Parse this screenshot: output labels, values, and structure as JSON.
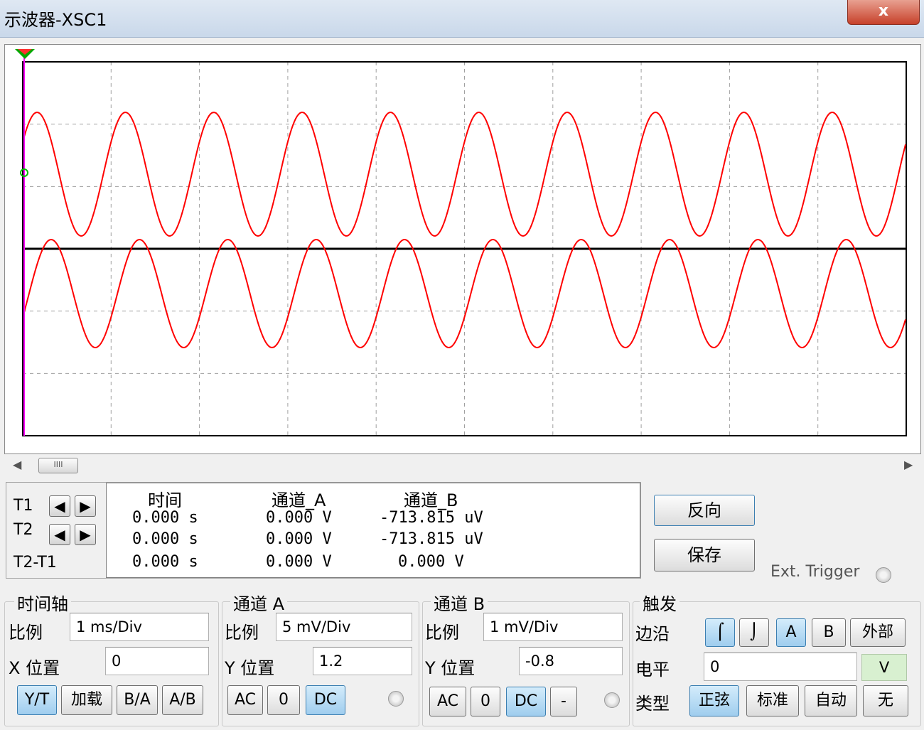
{
  "window": {
    "title": "示波器-XSC1",
    "close_label": "x"
  },
  "scroll": {
    "left": "◀",
    "right": "▶",
    "thumb": "IIII"
  },
  "cursors": {
    "t1_label": "T1",
    "t2_label": "T2",
    "diff_label": "T2-T1",
    "left_arrow": "◀",
    "right_arrow": "▶"
  },
  "readout": {
    "headers": [
      "时间",
      "通道_A",
      "通道_B"
    ],
    "rows": [
      [
        "0.000 s",
        "0.000 V",
        "-713.815 uV"
      ],
      [
        "0.000 s",
        "0.000 V",
        "-713.815 uV"
      ],
      [
        "0.000 s",
        "0.000 V",
        "0.000 V"
      ]
    ]
  },
  "actions": {
    "reverse": "反向",
    "save": "保存",
    "ext_trigger": "Ext. Trigger"
  },
  "timebase": {
    "title": "时间轴",
    "scale_label": "比例",
    "scale": "1 ms/Div",
    "xpos_label": "X 位置",
    "xpos": "0",
    "modes": [
      "Y/T",
      "加载",
      "B/A",
      "A/B"
    ],
    "active_mode": "Y/T"
  },
  "channel_a": {
    "title": "通道 A",
    "scale_label": "比例",
    "scale": "5 mV/Div",
    "ypos_label": "Y 位置",
    "ypos": "1.2",
    "coupling": [
      "AC",
      "0",
      "DC"
    ],
    "active": "DC"
  },
  "channel_b": {
    "title": "通道 B",
    "scale_label": "比例",
    "scale": "1 mV/Div",
    "ypos_label": "Y 位置",
    "ypos": "-0.8",
    "coupling": [
      "AC",
      "0",
      "DC",
      "-"
    ],
    "active": "DC"
  },
  "trigger": {
    "title": "触发",
    "edge_label": "边沿",
    "level_label": "电平",
    "level": "0",
    "level_unit": "V",
    "type_label": "类型",
    "edge_buttons": [
      "⌠",
      "⌡",
      "A",
      "B",
      "外部"
    ],
    "active_edge": "A",
    "types": [
      "正弦",
      "标准",
      "自动",
      "无"
    ],
    "active_type": "正弦"
  },
  "colors": {
    "trace": "#ff0000",
    "cursor": "#ff00ff",
    "grid": "#a0a0a0",
    "background": "#ffffff"
  }
}
